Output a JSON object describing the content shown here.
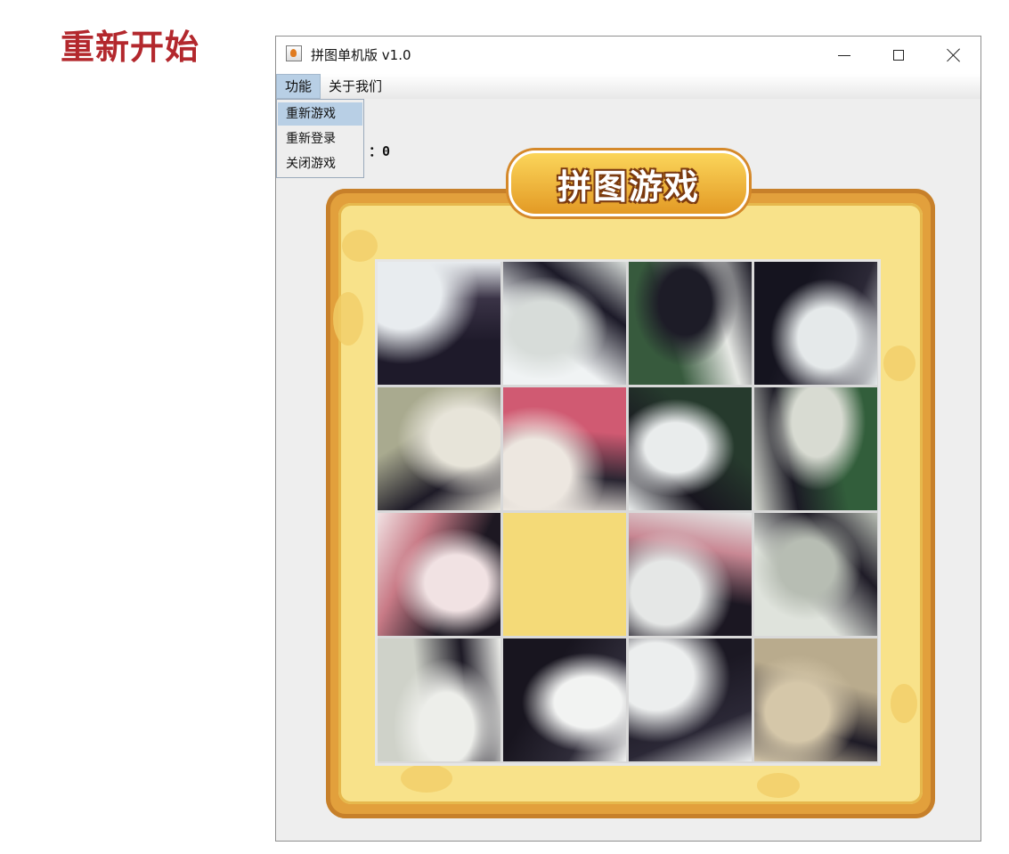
{
  "page": {
    "heading": "重新开始"
  },
  "window": {
    "title": "拼图单机版 v1.0",
    "min_glyph": "minimize-icon",
    "max_glyph": "maximize-icon",
    "close_glyph": "close-icon"
  },
  "menubar": {
    "items": [
      {
        "label": "功能"
      },
      {
        "label": "关于我们"
      }
    ]
  },
  "dropdown": {
    "items": [
      {
        "label": "重新游戏",
        "selected": true
      },
      {
        "label": "重新登录",
        "selected": false
      },
      {
        "label": "关闭游戏",
        "selected": false
      }
    ]
  },
  "game": {
    "step_text": "：0",
    "badge_text": "拼图游戏",
    "grid_rows": 4,
    "grid_cols": 4,
    "empty_tile_index": 9
  },
  "colors": {
    "heading_red": "#b3282d",
    "frame_orange": "#e2a03c",
    "frame_yellow": "#f8e28a",
    "empty_tile": "#f4da78",
    "menu_highlight": "#b8cfe5"
  }
}
